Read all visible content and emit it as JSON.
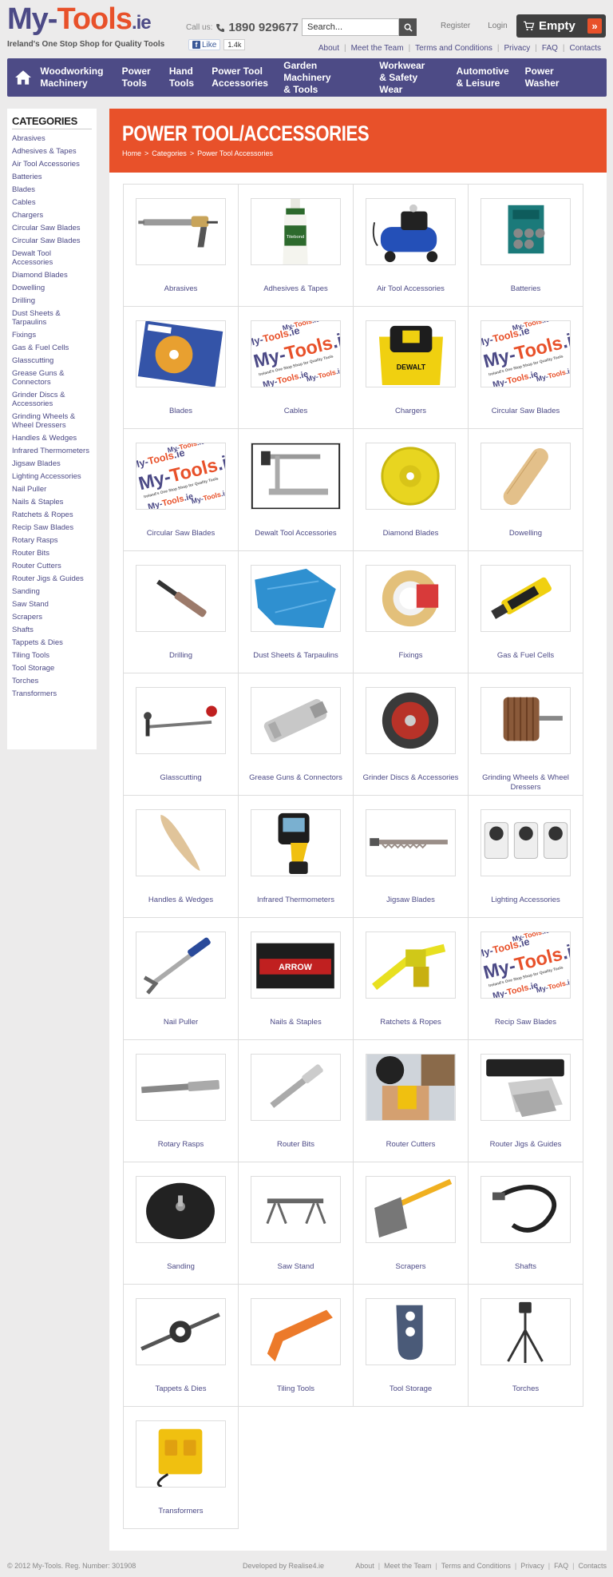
{
  "header": {
    "logo_part1": "My-",
    "logo_part2": "Tools",
    "logo_part3": ".ie",
    "tagline": "Ireland's One Stop Shop for Quality Tools",
    "callus_label": "Call us:",
    "phone": "1890 929677",
    "fb_like": "Like",
    "fb_count": "1.4k",
    "search_value": "Search...",
    "register": "Register",
    "login": "Login",
    "cart_label": "Empty",
    "cart_go": "»",
    "top_links": [
      "About",
      "Meet the Team",
      "Terms and Conditions",
      "Privacy",
      "FAQ",
      "Contacts"
    ]
  },
  "nav": {
    "items": [
      "Woodworking Machinery",
      "Power Tools",
      "Hand Tools",
      "Power Tool Accessories",
      "Garden Machinery & Tools",
      "Workwear & Safety Wear",
      "Automotive & Leisure",
      "Power Washer"
    ]
  },
  "sidebar": {
    "title": "CATEGORIES",
    "items": [
      "Abrasives",
      "Adhesives & Tapes",
      "Air Tool Accessories",
      "Batteries",
      "Blades",
      "Cables",
      "Chargers",
      "Circular Saw Blades",
      "Circular Saw Blades",
      "Dewalt Tool Accessories",
      "Diamond Blades",
      "Dowelling",
      "Drilling",
      "Dust Sheets & Tarpaulins",
      "Fixings",
      "Gas & Fuel Cells",
      "Glasscutting",
      "Grease Guns & Connectors",
      "Grinder Discs & Accessories",
      "Grinding Wheels & Wheel Dressers",
      "Handles & Wedges",
      "Infrared Thermometers",
      "Jigsaw Blades",
      "Lighting Accessories",
      "Nail Puller",
      "Nails & Staples",
      "Ratchets & Ropes",
      "Recip Saw Blades",
      "Rotary Rasps",
      "Router Bits",
      "Router Cutters",
      "Router Jigs & Guides",
      "Sanding",
      "Saw Stand",
      "Scrapers",
      "Shafts",
      "Tappets & Dies",
      "Tiling Tools",
      "Tool Storage",
      "Torches",
      "Transformers"
    ]
  },
  "main": {
    "title": "POWER TOOL/ACCESSORIES",
    "breadcrumb": [
      "Home",
      ">",
      "Categories",
      ">",
      "Power Tool Accessories"
    ],
    "categories": [
      {
        "label": "Abrasives",
        "icon": "grease-gun-icon"
      },
      {
        "label": "Adhesives & Tapes",
        "icon": "glue-bottle-icon"
      },
      {
        "label": "Air Tool Accessories",
        "icon": "air-compressor-icon"
      },
      {
        "label": "Batteries",
        "icon": "battery-pack-icon"
      },
      {
        "label": "Blades",
        "icon": "blade-pack-icon"
      },
      {
        "label": "Cables",
        "icon": "placeholder-logo-icon"
      },
      {
        "label": "Chargers",
        "icon": "charger-icon"
      },
      {
        "label": "Circular Saw Blades",
        "icon": "placeholder-logo-icon"
      },
      {
        "label": "Circular Saw Blades",
        "icon": "placeholder-logo-icon"
      },
      {
        "label": "Dewalt Tool Accessories",
        "icon": "clamp-icon"
      },
      {
        "label": "Diamond Blades",
        "icon": "diamond-blade-icon"
      },
      {
        "label": "Dowelling",
        "icon": "dowel-icon"
      },
      {
        "label": "Drilling",
        "icon": "bit-holder-icon"
      },
      {
        "label": "Dust Sheets & Tarpaulins",
        "icon": "tarpaulin-icon"
      },
      {
        "label": "Fixings",
        "icon": "tape-roll-icon"
      },
      {
        "label": "Gas & Fuel Cells",
        "icon": "fuel-cell-icon"
      },
      {
        "label": "Glasscutting",
        "icon": "glass-cutter-icon"
      },
      {
        "label": "Grease Guns & Connectors",
        "icon": "grease-connector-icon"
      },
      {
        "label": "Grinder Discs & Accessories",
        "icon": "cutting-disc-icon"
      },
      {
        "label": "Grinding Wheels & Wheel Dressers",
        "icon": "flap-wheel-icon"
      },
      {
        "label": "Handles & Wedges",
        "icon": "handle-icon"
      },
      {
        "label": "Infrared Thermometers",
        "icon": "thermometer-icon"
      },
      {
        "label": "Jigsaw Blades",
        "icon": "jigsaw-blade-icon"
      },
      {
        "label": "Lighting Accessories",
        "icon": "timer-plug-icon"
      },
      {
        "label": "Nail Puller",
        "icon": "nail-puller-icon"
      },
      {
        "label": "Nails & Staples",
        "icon": "staples-box-icon"
      },
      {
        "label": "Ratchets & Ropes",
        "icon": "ratchet-strap-icon"
      },
      {
        "label": "Recip Saw Blades",
        "icon": "placeholder-logo-icon"
      },
      {
        "label": "Rotary Rasps",
        "icon": "rotary-rasp-icon"
      },
      {
        "label": "Router Bits",
        "icon": "router-bit-icon"
      },
      {
        "label": "Router Cutters",
        "icon": "router-cutter-icon"
      },
      {
        "label": "Router Jigs & Guides",
        "icon": "router-jig-icon"
      },
      {
        "label": "Sanding",
        "icon": "sanding-pad-icon"
      },
      {
        "label": "Saw Stand",
        "icon": "saw-stand-icon"
      },
      {
        "label": "Scrapers",
        "icon": "scraper-icon"
      },
      {
        "label": "Shafts",
        "icon": "flexible-shaft-icon"
      },
      {
        "label": "Tappets & Dies",
        "icon": "die-wrench-icon"
      },
      {
        "label": "Tiling Tools",
        "icon": "tile-scraper-icon"
      },
      {
        "label": "Tool Storage",
        "icon": "holster-icon"
      },
      {
        "label": "Torches",
        "icon": "tripod-icon"
      },
      {
        "label": "Transformers",
        "icon": "transformer-icon"
      }
    ]
  },
  "footer": {
    "copyright": "© 2012 My-Tools. Reg. Number: 301908",
    "developed": "Developed by Realise4.ie",
    "links": [
      "About",
      "Meet the Team",
      "Terms and Conditions",
      "Privacy",
      "FAQ",
      "Contacts"
    ]
  },
  "colors": {
    "brand_purple": "#4d4b86",
    "brand_orange": "#e8512a",
    "background": "#ecebeb"
  }
}
